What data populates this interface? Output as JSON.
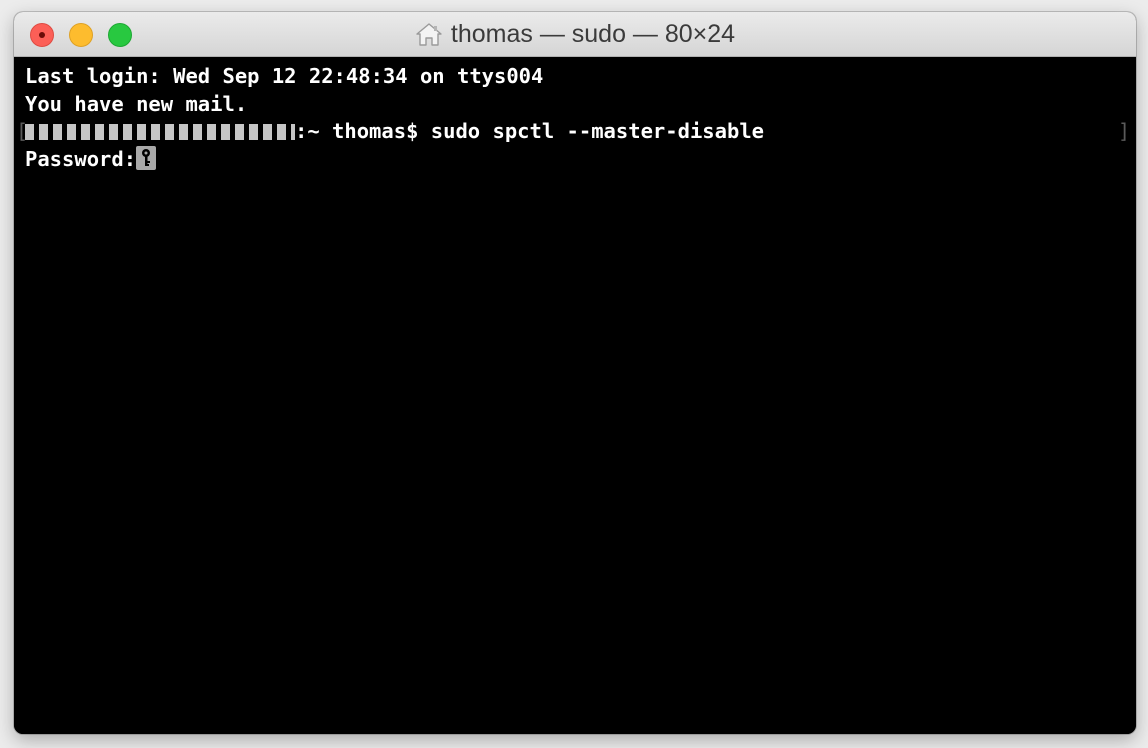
{
  "window": {
    "title": "thomas — sudo — 80×24",
    "title_icon": "home-icon"
  },
  "controls": {
    "close": "close-button",
    "minimize": "minimize-button",
    "zoom": "zoom-button"
  },
  "terminal": {
    "line1": "Last login: Wed Sep 12 22:48:34 on ttys004",
    "line2": "You have new mail.",
    "prompt_suffix": ":~ thomas$ ",
    "command": "sudo spctl --master-disable",
    "password_label": "Password:",
    "bracket_left": "[",
    "bracket_right": "]"
  },
  "colors": {
    "background": "#000000",
    "text": "#ffffff",
    "close": "#fc5f57",
    "minimize": "#fdbc2e",
    "zoom": "#28c840"
  }
}
